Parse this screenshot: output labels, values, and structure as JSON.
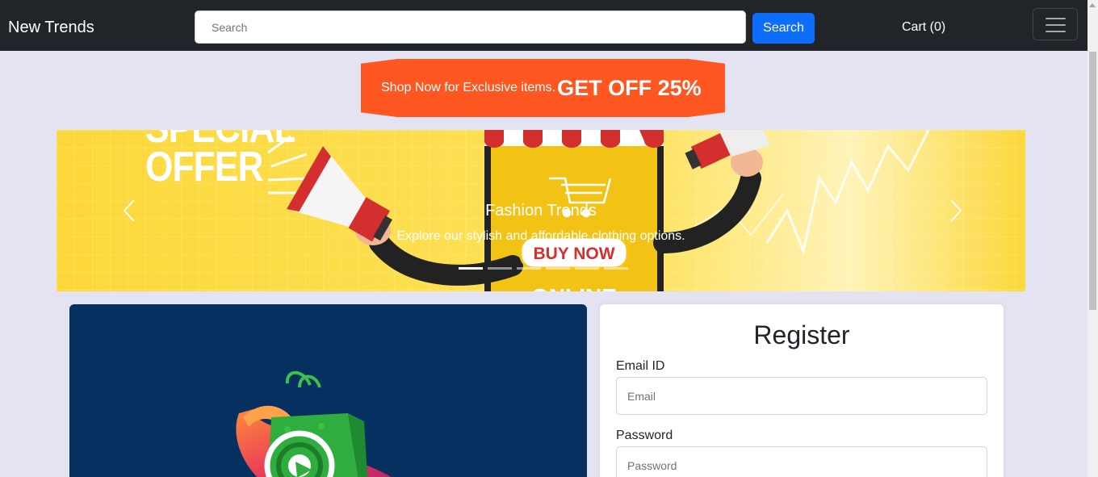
{
  "navbar": {
    "brand": "New Trends",
    "search_placeholder": "Search",
    "search_button": "Search",
    "cart_label": "Cart (0)"
  },
  "promo": {
    "text": "Shop Now for Exclusive items.",
    "highlight": "GET OFF 25%"
  },
  "carousel": {
    "image_text_offer": "SPECIAL\nOFFER",
    "image_text_buy": "BUY NOW",
    "image_text_online": "ONLINE",
    "caption_title": "Fashion Trends",
    "caption_text": "Explore our stylish and affordable clothing options.",
    "slide_count": 6,
    "active_slide": 1
  },
  "register": {
    "title": "Register",
    "email_label": "Email ID",
    "email_placeholder": "Email",
    "password_label": "Password",
    "password_placeholder": "Password"
  },
  "colors": {
    "navbar_bg": "#212529",
    "page_bg": "#e4e3f2",
    "primary": "#0d6efd",
    "promo_bg": "#ff5722",
    "banner_yellow": "#fcd83a",
    "image_card_bg": "#05305f"
  }
}
